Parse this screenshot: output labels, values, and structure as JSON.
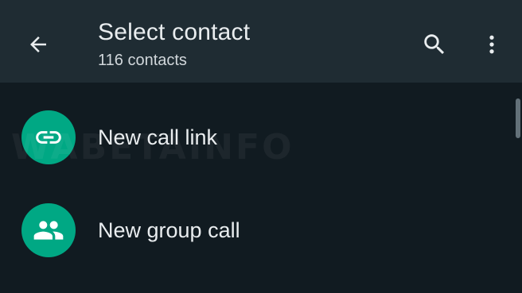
{
  "app_bar": {
    "title": "Select contact",
    "subtitle": "116 contacts",
    "back_icon": "arrow-back-icon",
    "search_icon": "search-icon",
    "menu_icon": "more-vert-icon"
  },
  "list": {
    "items": [
      {
        "label": "New call link",
        "icon": "link-icon"
      },
      {
        "label": "New group call",
        "icon": "group-icon"
      }
    ]
  },
  "watermark": "WABETAINFO",
  "colors": {
    "background": "#111b21",
    "app_bar": "#1f2c33",
    "accent": "#00a884",
    "text_primary": "#e9edef",
    "text_secondary": "#d1d7db"
  }
}
